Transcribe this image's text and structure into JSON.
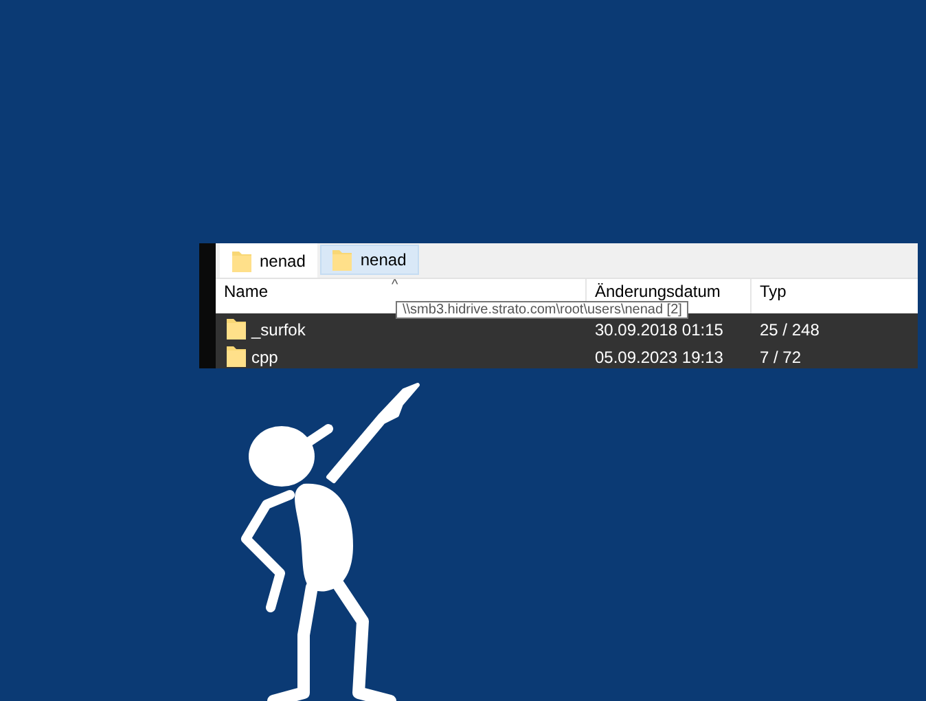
{
  "tabs": [
    {
      "label": "nenad",
      "selected": true
    },
    {
      "label": "nenad",
      "selected": false
    }
  ],
  "columns": [
    "Name",
    "Änderungsdatum",
    "Typ"
  ],
  "sort_indicator": "^",
  "tooltip": "\\\\smb3.hidrive.strato.com\\root\\users\\nenad [2]",
  "rows": [
    {
      "name": "_surfok",
      "date": "30.09.2018 01:15",
      "type": "25 / 248"
    },
    {
      "name": "cpp",
      "date": "05.09.2023 19:13",
      "type": "7 / 72"
    }
  ]
}
